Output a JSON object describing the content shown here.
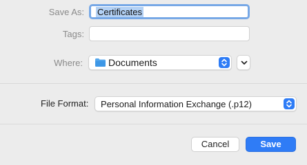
{
  "save_as": {
    "label": "Save As:",
    "value": "Certificates"
  },
  "tags": {
    "label": "Tags:",
    "value": ""
  },
  "where": {
    "label": "Where:",
    "selected": "Documents",
    "folder_icon": "folder-icon"
  },
  "file_format": {
    "label": "File Format:",
    "selected": "Personal Information Exchange (.p12)"
  },
  "buttons": {
    "cancel": "Cancel",
    "save": "Save"
  },
  "colors": {
    "accent": "#2f7cf6",
    "selection": "#b3d1f5",
    "focus_ring": "#77a8e6"
  }
}
